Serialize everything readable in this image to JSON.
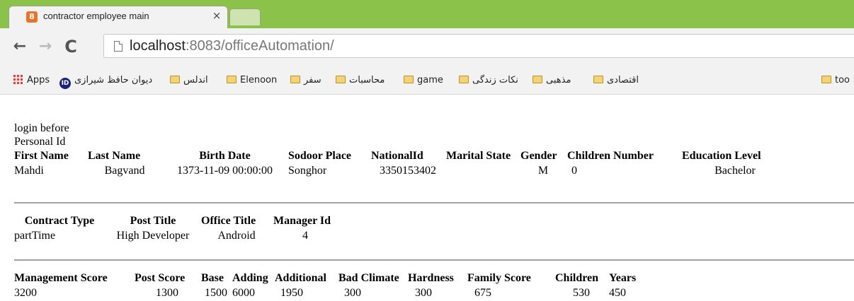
{
  "browser": {
    "tab_title": "contractor employee main",
    "tab_close": "×",
    "favicon_label": "8",
    "url_host": "localhost",
    "url_rest": ":8083/officeAutomation/",
    "back_glyph": "←",
    "forward_glyph": "→",
    "reload_glyph": "C",
    "bookmarks": [
      "Apps",
      "دیوان حافظ شیرازی",
      "اندلس",
      "Elenoon",
      "سفر",
      "محاسبات",
      "game",
      "نکات زندگی",
      "مذهبی",
      "اقتصادی",
      "too"
    ]
  },
  "page": {
    "login_text": "login before",
    "personal_id_label": "Personal Id",
    "personal": {
      "headers": [
        "First Name",
        "Last Name",
        "Birth Date",
        "Sodoor Place",
        "NationalId",
        "Marital State",
        "Gender",
        "Children Number",
        "Education Level"
      ],
      "row": [
        "Mahdi",
        "Bagvand",
        "1373-11-09 00:00:00",
        "Songhor",
        "3350153402",
        "",
        "M",
        "0",
        "Bachelor"
      ]
    },
    "contract": {
      "headers": [
        "Contract Type",
        "Post Title",
        "Office Title",
        "Manager Id"
      ],
      "row": [
        "partTime",
        "High Developer",
        "Android",
        "4"
      ]
    },
    "salary": {
      "headers": [
        "Management Score",
        "Post Score",
        "Base",
        "Adding",
        "Additional",
        "Bad Climate",
        "Hardness",
        "Family Score",
        "Children",
        "Years"
      ],
      "row": [
        "3200",
        "1300",
        "1500",
        "6000",
        "1950",
        "300",
        "300",
        "675",
        "530",
        "450"
      ]
    }
  }
}
